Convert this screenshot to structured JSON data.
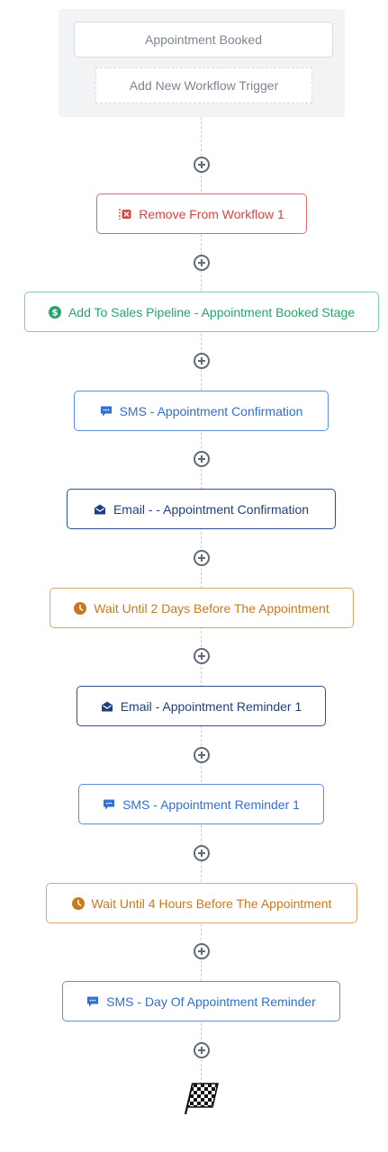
{
  "trigger": {
    "current": "Appointment Booked",
    "add_label": "Add New Workflow Trigger"
  },
  "steps": [
    {
      "label": "Remove From Workflow 1",
      "icon": "remove-workflow-icon",
      "color": "#d64545"
    },
    {
      "label": "Add To Sales Pipeline - Appointment Booked Stage",
      "icon": "dollar-icon",
      "color": "#27a46a"
    },
    {
      "label": "SMS - Appointment Confirmation",
      "icon": "sms-icon",
      "color": "#2f6fd6"
    },
    {
      "label": "Email - - Appointment Confirmation",
      "icon": "email-icon",
      "color": "#1f3f7f"
    },
    {
      "label": "Wait Until 2 Days Before The Appointment",
      "icon": "clock-icon",
      "color": "#c9791d"
    },
    {
      "label": "Email - Appointment Reminder 1",
      "icon": "email-icon",
      "color": "#1f3f7f"
    },
    {
      "label": "SMS - Appointment Reminder 1",
      "icon": "sms-icon",
      "color": "#2f6fd6"
    },
    {
      "label": "Wait Until 4 Hours Before The Appointment",
      "icon": "clock-icon",
      "color": "#c9791d"
    },
    {
      "label": "SMS - Day Of Appointment Reminder",
      "icon": "sms-icon",
      "color": "#2f6fd6"
    }
  ],
  "end_icon": "checkered-flag-icon"
}
